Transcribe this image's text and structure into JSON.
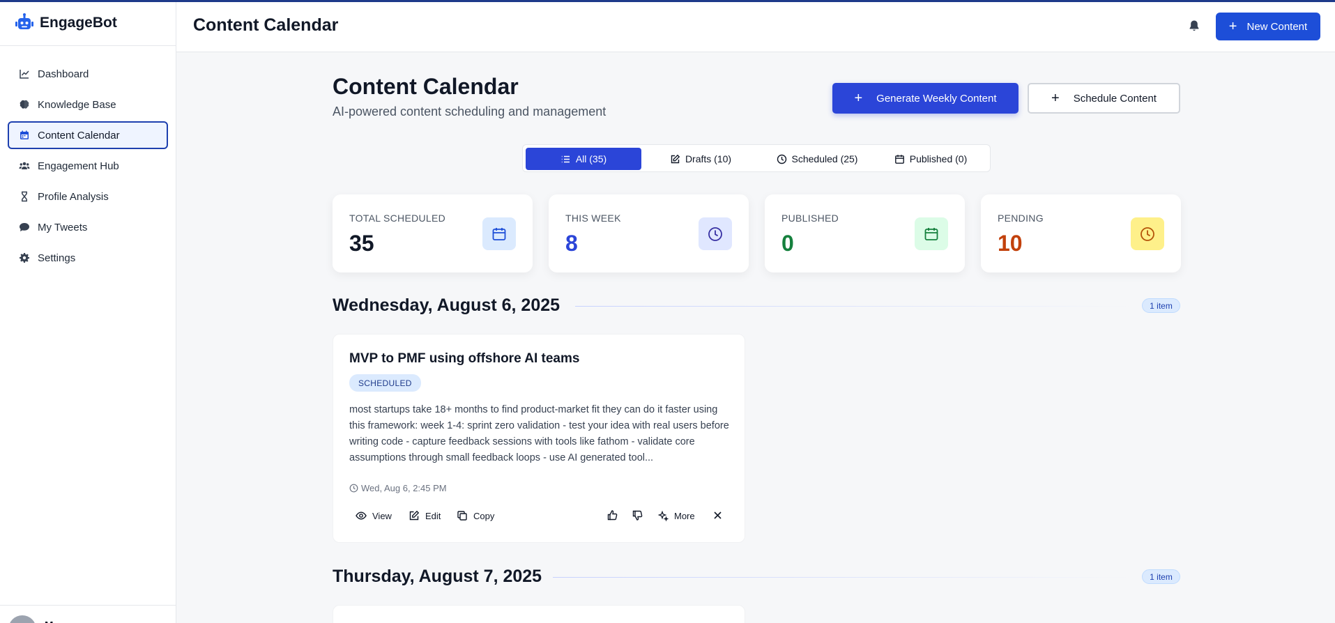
{
  "app": {
    "name": "EngageBot"
  },
  "sidebar": {
    "items": [
      {
        "label": "Dashboard",
        "icon": "chart-line-icon"
      },
      {
        "label": "Knowledge Base",
        "icon": "brain-icon"
      },
      {
        "label": "Content Calendar",
        "icon": "calendar-icon",
        "active": true
      },
      {
        "label": "Engagement Hub",
        "icon": "users-icon"
      },
      {
        "label": "Profile Analysis",
        "icon": "hourglass-icon"
      },
      {
        "label": "My Tweets",
        "icon": "comment-icon"
      },
      {
        "label": "Settings",
        "icon": "gear-icon"
      }
    ],
    "user_initial": "M"
  },
  "header": {
    "title": "Content Calendar",
    "new_button": "New Content"
  },
  "page": {
    "title": "Content Calendar",
    "subtitle": "AI-powered content scheduling and management",
    "generate_button": "Generate Weekly Content",
    "schedule_button": "Schedule Content"
  },
  "tabs": [
    {
      "label": "All (35)",
      "icon": "list-icon",
      "active": true
    },
    {
      "label": "Drafts (10)",
      "icon": "edit-icon"
    },
    {
      "label": "Scheduled (25)",
      "icon": "clock-icon"
    },
    {
      "label": "Published (0)",
      "icon": "calendar-icon"
    }
  ],
  "stats": [
    {
      "label": "TOTAL SCHEDULED",
      "value": "35",
      "color": "#111827",
      "icon_bg": "#dbeafe",
      "icon_color": "#1d4ed8",
      "icon": "calendar-icon"
    },
    {
      "label": "THIS WEEK",
      "value": "8",
      "color": "#2b45d8",
      "icon_bg": "#e0e7ff",
      "icon_color": "#3730a3",
      "icon": "clock-icon"
    },
    {
      "label": "PUBLISHED",
      "value": "0",
      "color": "#15803d",
      "icon_bg": "#dcfce7",
      "icon_color": "#15803d",
      "icon": "calendar-icon"
    },
    {
      "label": "PENDING",
      "value": "10",
      "color": "#c2410c",
      "icon_bg": "#fef08a",
      "icon_color": "#b45309",
      "icon": "clock-icon"
    }
  ],
  "days": [
    {
      "date": "Wednesday, August 6, 2025",
      "count": "1 item",
      "post": {
        "title": "MVP to PMF using offshore AI teams",
        "status": "SCHEDULED",
        "body": "most startups take 18+ months to find product-market fit they can do it faster using this framework: week 1-4: sprint zero validation - test your idea with real users before writing code - capture feedback sessions with tools like fathom - validate core assumptions through small feedback loops - use AI generated tool...",
        "time": "Wed, Aug 6, 2:45 PM",
        "actions": {
          "view": "View",
          "edit": "Edit",
          "copy": "Copy",
          "more": "More"
        }
      }
    },
    {
      "date": "Thursday, August 7, 2025",
      "count": "1 item"
    }
  ]
}
